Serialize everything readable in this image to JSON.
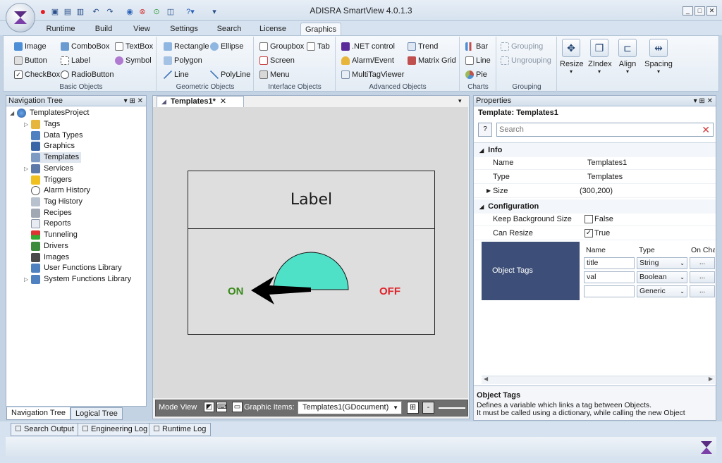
{
  "window": {
    "title": "ADISRA SmartView 4.0.1.3"
  },
  "ribbon_tabs": [
    "Runtime",
    "Build",
    "View",
    "Settings",
    "Search",
    "License",
    "Graphics"
  ],
  "active_tab": "Graphics",
  "ribbon": {
    "basic": {
      "label": "Basic Objects",
      "items": [
        "Image",
        "ComboBox",
        "TextBox",
        "Button",
        "Label",
        "Symbol",
        "CheckBox",
        "RadioButton"
      ]
    },
    "geometric": {
      "label": "Geometric Objects",
      "items": [
        "Rectangle",
        "Ellipse",
        "Polygon",
        "Line",
        "PolyLine"
      ]
    },
    "interface": {
      "label": "Interface Objects",
      "items": [
        "Groupbox",
        "Tab",
        "Screen",
        "Menu"
      ]
    },
    "advanced": {
      "label": "Advanced Objects",
      "items": [
        ".NET control",
        "Trend",
        "Alarm/Event",
        "Matrix Grid",
        "MultiTagViewer"
      ]
    },
    "charts": {
      "label": "Charts",
      "items": [
        "Bar",
        "Line",
        "Pie"
      ]
    },
    "grouping": {
      "label": "Grouping",
      "items": [
        "Grouping",
        "Ungrouping"
      ]
    },
    "big": [
      "Resize",
      "ZIndex",
      "Align",
      "Spacing"
    ]
  },
  "nav": {
    "title": "Navigation Tree",
    "root": "TemplatesProject",
    "items": [
      "Tags",
      "Data Types",
      "Graphics",
      "Templates",
      "Services",
      "Triggers",
      "Alarm History",
      "Tag History",
      "Recipes",
      "Reports",
      "Tunneling",
      "Drivers",
      "Images",
      "User Functions Library",
      "System Functions Library"
    ],
    "selected": "Templates",
    "tabs": [
      "Navigation Tree",
      "Logical Tree"
    ]
  },
  "doc": {
    "tab": "Templates1*",
    "label_text": "Label",
    "on_text": "ON",
    "off_text": "OFF",
    "mode_view": "Mode View",
    "graphic_items": "Graphic Items:",
    "graphic_select": "Templates1(GDocument)",
    "zoom_minus": "-"
  },
  "props": {
    "title": "Properties",
    "template_label": "Template:",
    "template_name": "Templates1",
    "help_btn": "?",
    "search_placeholder": "Search",
    "info": "Info",
    "name_label": "Name",
    "name_value": "Templates1",
    "type_label": "Type",
    "type_value": "Templates",
    "size_label": "Size",
    "size_value": "(300,200)",
    "configuration": "Configuration",
    "kbs_label": "Keep Background Size",
    "kbs_value": "False",
    "cr_label": "Can Resize",
    "cr_value": "True",
    "object_tags": "Object Tags",
    "table_headers": [
      "Name",
      "Type",
      "On Cha"
    ],
    "table_rows": [
      {
        "name": "title",
        "type": "String",
        "btn": "..."
      },
      {
        "name": "val",
        "type": "Boolean",
        "btn": "..."
      },
      {
        "name": "",
        "type": "Generic",
        "btn": "..."
      }
    ],
    "desc_title": "Object Tags",
    "desc_text": "Defines a variable which links a tag between Objects.",
    "desc_text2": "It must be called using a dictionary, while calling the new Object"
  },
  "logs": [
    "Search Output",
    "Engineering Log",
    "Runtime Log"
  ],
  "colors": {
    "on": "#3a8a1a",
    "off": "#e0232b",
    "gauge": "#4fe0c8",
    "object_tags_bg": "#3d4f78"
  }
}
